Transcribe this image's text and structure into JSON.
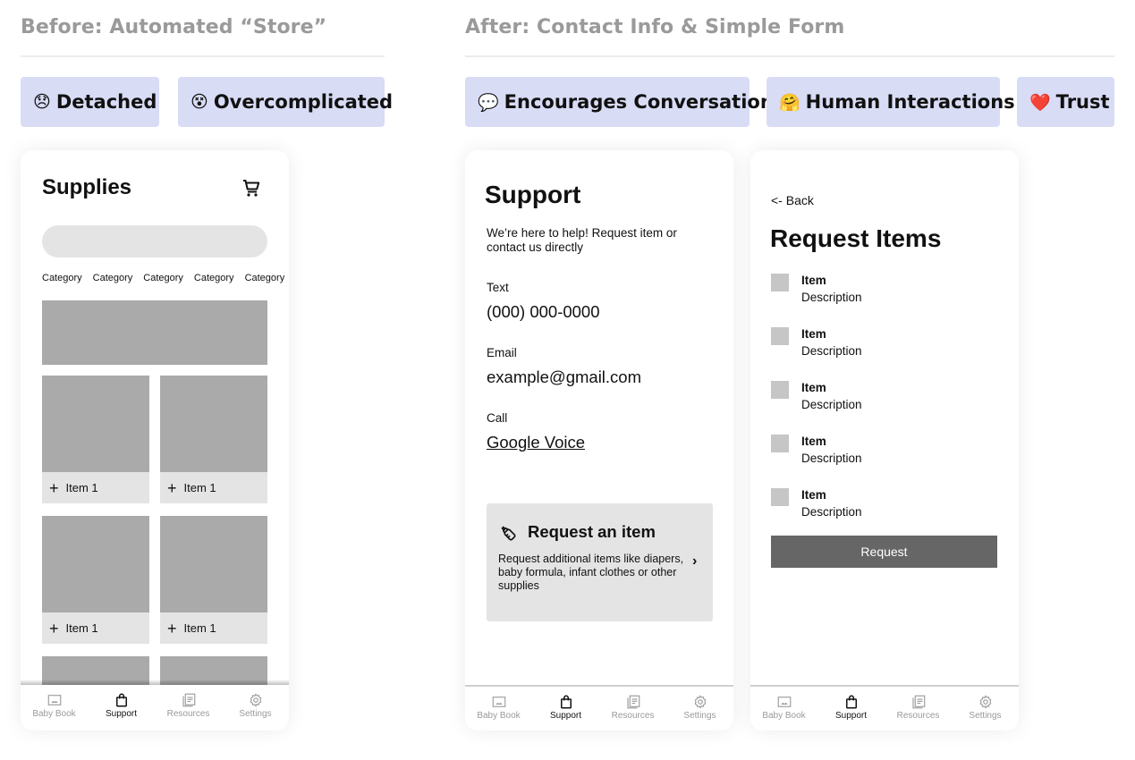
{
  "before": {
    "heading": "Before: Automated “Store”",
    "tags": [
      {
        "emoji": "😞",
        "emoji_name": "disappointed-face-icon",
        "label": "Detached"
      },
      {
        "emoji": "😵",
        "emoji_name": "dizzy-face-icon",
        "label": "Overcomplicated"
      }
    ],
    "supplies_screen": {
      "title": "Supplies",
      "cart_icon": "cart-icon",
      "search_placeholder": "",
      "categories": [
        "Category",
        "Category",
        "Category",
        "Category",
        "Category"
      ],
      "products": [
        {
          "label": "Item 1"
        },
        {
          "label": "Item 1"
        },
        {
          "label": "Item 1"
        },
        {
          "label": "Item 1"
        }
      ]
    }
  },
  "after": {
    "heading": "After: Contact Info & Simple Form",
    "tags": [
      {
        "emoji": "💬",
        "emoji_name": "speech-bubble-icon",
        "label": "Encourages Conversation"
      },
      {
        "emoji": "🤗",
        "emoji_name": "hugging-face-icon",
        "label": "Human Interactions"
      },
      {
        "emoji": "❤️",
        "emoji_name": "heart-icon",
        "label": "Trust"
      }
    ],
    "support_screen": {
      "title": "Support",
      "intro": "We’re here to help! Request item or contact us directly",
      "contacts": [
        {
          "label": "Text",
          "value": "(000) 000-0000"
        },
        {
          "label": "Email",
          "value": "example@gmail.com"
        },
        {
          "label": "Call",
          "value": "Google Voice"
        }
      ],
      "request_card": {
        "title": "Request an item",
        "description": "Request additional items like diapers, baby formula, infant clothes or other supplies",
        "chevron": "›"
      }
    },
    "request_screen": {
      "back": "<- Back",
      "title": "Request Items",
      "items": [
        {
          "name": "Item",
          "description": "Description"
        },
        {
          "name": "Item",
          "description": "Description"
        },
        {
          "name": "Item",
          "description": "Description"
        },
        {
          "name": "Item",
          "description": "Description"
        },
        {
          "name": "Item",
          "description": "Description"
        }
      ],
      "button": "Request"
    }
  },
  "tabbar": {
    "tabs": [
      {
        "label": "Baby Book",
        "icon": "photo-icon"
      },
      {
        "label": "Support",
        "icon": "shopping-bag-icon",
        "active": true
      },
      {
        "label": "Resources",
        "icon": "documents-icon"
      },
      {
        "label": "Settings",
        "icon": "gear-icon"
      }
    ]
  },
  "colors": {
    "chip_bg": "#d8dcf5",
    "placeholder_gray": "#aaaaaa",
    "light_gray": "#e4e4e4",
    "button_gray": "#666666",
    "heading_gray": "#9a9a9a"
  }
}
